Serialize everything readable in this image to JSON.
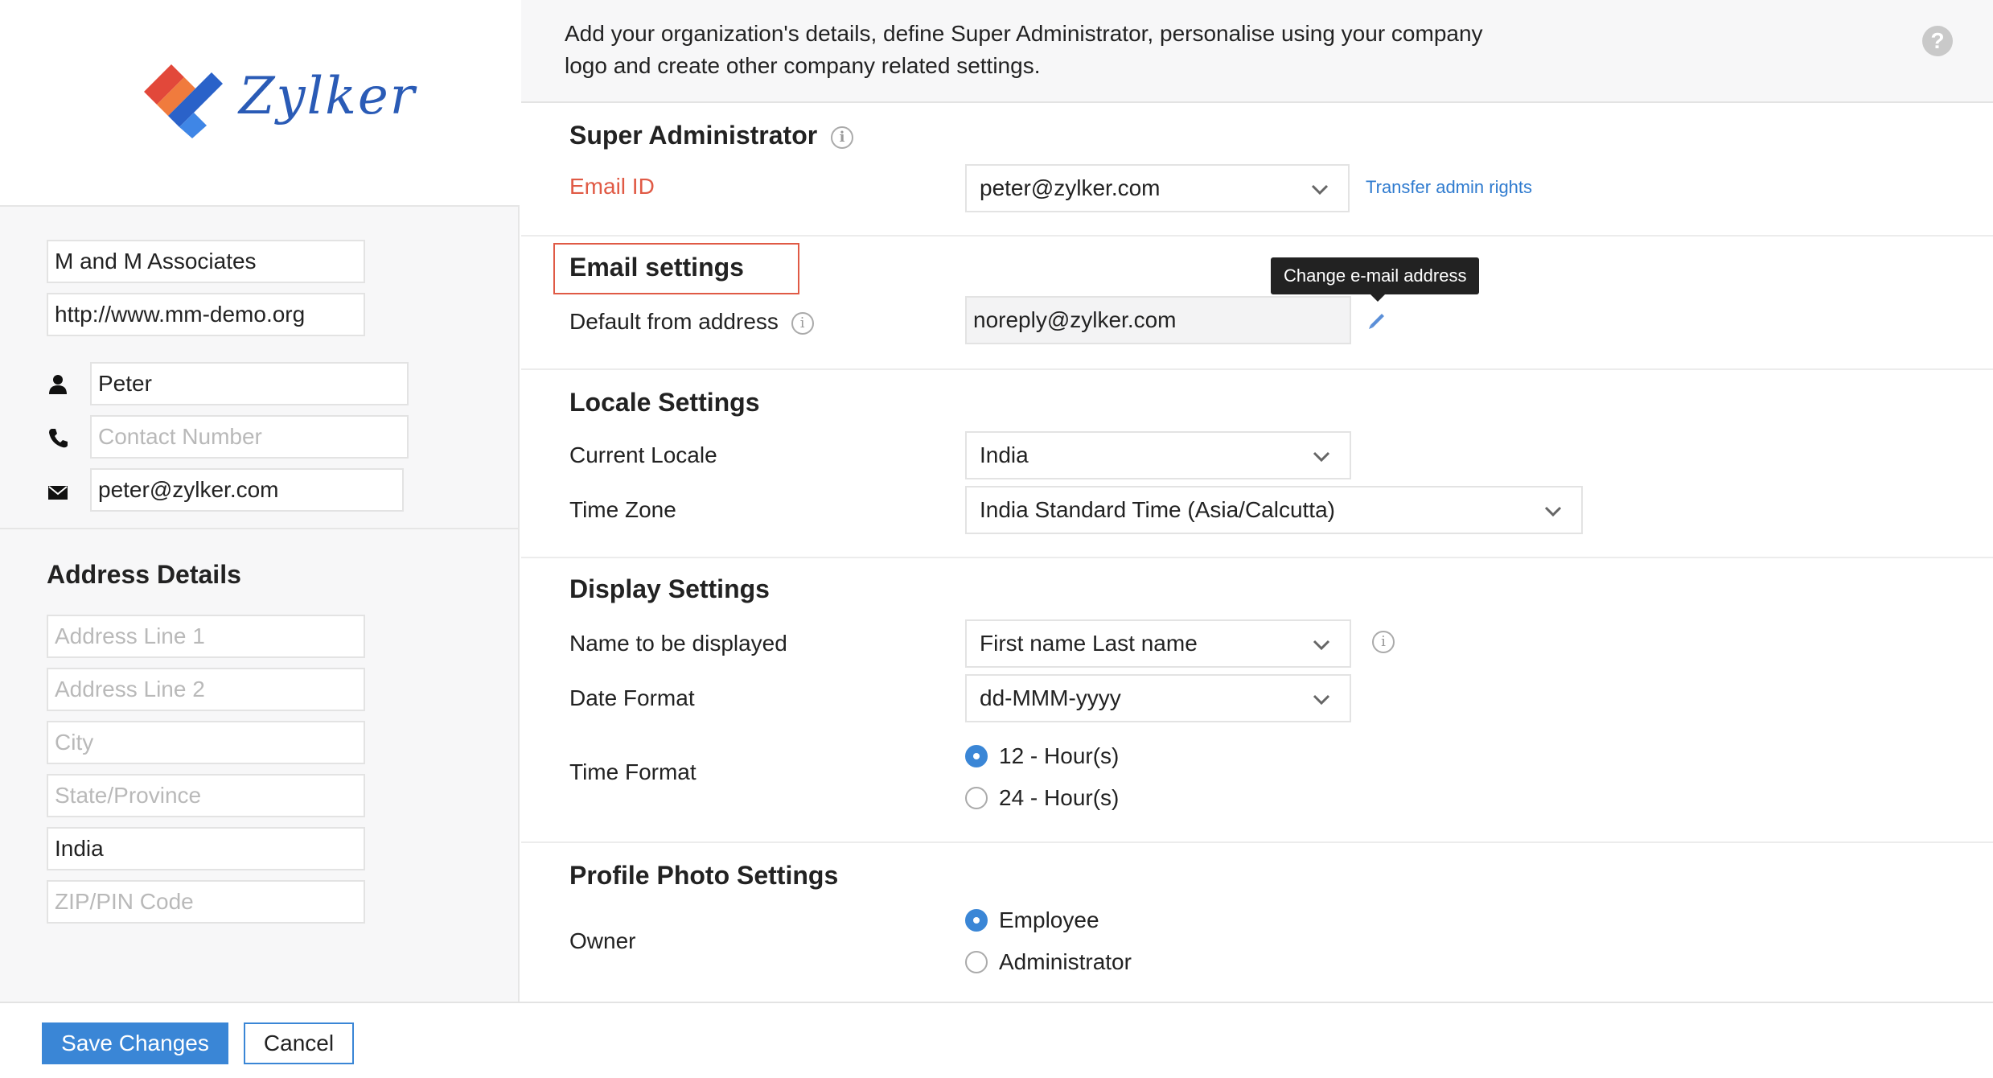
{
  "sidebar": {
    "logo_text": "Zylker",
    "org_name": "M and M Associates",
    "website": "http://www.mm-demo.org",
    "contact_name": "Peter",
    "contact_number_placeholder": "Contact Number",
    "contact_email": "peter@zylker.com",
    "address_heading": "Address Details",
    "address": {
      "line1_placeholder": "Address Line 1",
      "line2_placeholder": "Address Line 2",
      "city_placeholder": "City",
      "state_placeholder": "State/Province",
      "country": "India",
      "zip_placeholder": "ZIP/PIN Code"
    }
  },
  "intro": {
    "text": "Add your organization's details, define Super Administrator, personalise using your company logo and create other company related settings.",
    "help_icon": "?"
  },
  "super_admin": {
    "title": "Super Administrator",
    "email_label": "Email ID",
    "email_value": "peter@zylker.com",
    "transfer_link": "Transfer admin rights"
  },
  "email_settings": {
    "title": "Email settings",
    "default_from_label": "Default from address",
    "default_from_value": "noreply@zylker.com",
    "tooltip": "Change e-mail address"
  },
  "locale": {
    "title": "Locale Settings",
    "current_locale_label": "Current Locale",
    "current_locale_value": "India",
    "time_zone_label": "Time Zone",
    "time_zone_value": "India Standard Time (Asia/Calcutta)"
  },
  "display": {
    "title": "Display Settings",
    "name_label": "Name to be displayed",
    "name_value": "First name Last name",
    "date_label": "Date Format",
    "date_value": "dd-MMM-yyyy",
    "time_label": "Time Format",
    "time_options": [
      "12 - Hour(s)",
      "24 - Hour(s)"
    ]
  },
  "profile_photo": {
    "title": "Profile Photo Settings",
    "owner_label": "Owner",
    "owner_options": [
      "Employee",
      "Administrator"
    ]
  },
  "footer": {
    "save_label": "Save Changes",
    "cancel_label": "Cancel"
  },
  "colors": {
    "accent": "#3a86d6",
    "error_label": "#e05a45",
    "highlight_border": "#e05a45"
  }
}
